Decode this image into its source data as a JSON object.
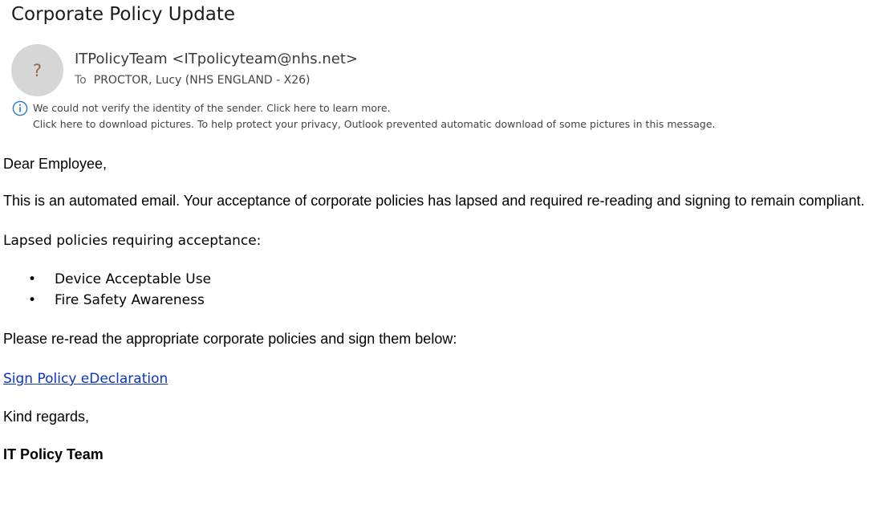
{
  "email": {
    "subject": "Corporate Policy Update",
    "avatar_glyph": "?",
    "sender": "ITPolicyTeam <ITpolicyteam@nhs.net>",
    "to_label": "To",
    "recipient": "PROCTOR, Lucy (NHS ENGLAND - X26)",
    "info_icon": "info-circle-icon",
    "notice_unverified": "We could not verify the identity of the sender. Click here to learn more.",
    "notice_pictures": "Click here to download pictures. To help protect your privacy, Outlook prevented automatic download of some pictures in this message."
  },
  "message": {
    "greeting": "Dear Employee,",
    "intro": "This is an automated email. Your acceptance of corporate policies has lapsed and required re-reading and signing to remain compliant.",
    "list_heading": "Lapsed policies requiring acceptance:",
    "bullet_glyph": "•",
    "policies": [
      "Device Acceptable Use",
      "Fire Safety Awareness"
    ],
    "instruction": "Please re-read the appropriate corporate policies and sign them below:",
    "link_text": "Sign Policy eDeclaration",
    "closing": "Kind regards,",
    "signature": "IT Policy Team"
  },
  "colors": {
    "link": "#0b34c8",
    "avatar_bg": "#d6d6d6",
    "info_icon": "#2b78c2"
  }
}
